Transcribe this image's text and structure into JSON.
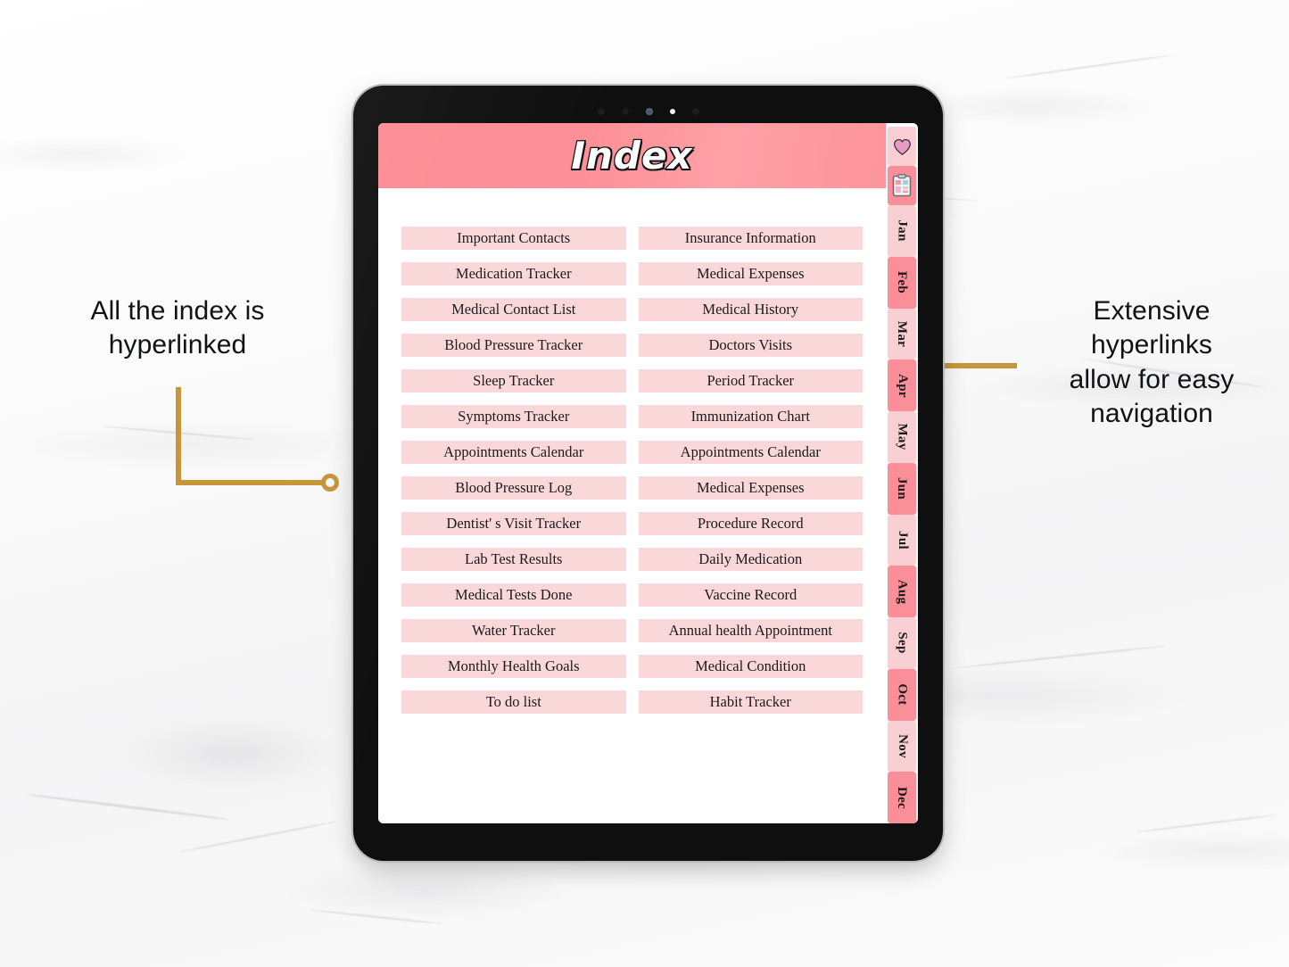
{
  "background": {
    "texture": "white-marble"
  },
  "annotations": {
    "left": {
      "text": "All the index is\nhyperlinked"
    },
    "right": {
      "text": "Extensive\nhyperlinks\nallow for easy\nnavigation"
    },
    "connector_color": "#c8963a"
  },
  "device": {
    "type": "tablet",
    "bezel_color": "#100f10",
    "camera_dots": [
      "dot",
      "dot",
      "camera",
      "led",
      "dot"
    ]
  },
  "page": {
    "title": "Index",
    "header_color": "#fb8b93",
    "button_color": "#fad7d9",
    "columns": [
      {
        "name": "left-column",
        "items": [
          "Important Contacts",
          "Medication Tracker",
          "Medical Contact List",
          "Blood Pressure Tracker",
          "Sleep Tracker",
          "Symptoms Tracker",
          "Appointments Calendar",
          "Blood Pressure Log",
          "Dentist' s Visit Tracker",
          "Lab Test Results",
          "Medical Tests Done",
          "Water Tracker",
          "Monthly Health Goals",
          "To do list"
        ]
      },
      {
        "name": "right-column",
        "items": [
          "Insurance Information",
          "Medical Expenses",
          "Medical History",
          "Doctors Visits",
          "Period Tracker",
          "Immunization Chart",
          "Appointments Calendar",
          "Medical Expenses",
          "Procedure Record",
          "Daily Medication",
          "Vaccine Record",
          "Annual health Appointment",
          "Medical Condition",
          "Habit Tracker"
        ]
      }
    ]
  },
  "tab_strip": {
    "icon_tabs": [
      {
        "icon": "heart-icon",
        "style": "light"
      },
      {
        "icon": "clipboard-icon",
        "style": "dark"
      }
    ],
    "months": [
      {
        "label": "Jan",
        "style": "light"
      },
      {
        "label": "Feb",
        "style": "dark"
      },
      {
        "label": "Mar",
        "style": "light"
      },
      {
        "label": "Apr",
        "style": "dark"
      },
      {
        "label": "May",
        "style": "light"
      },
      {
        "label": "Jun",
        "style": "dark"
      },
      {
        "label": "Jul",
        "style": "light"
      },
      {
        "label": "Aug",
        "style": "dark"
      },
      {
        "label": "Sep",
        "style": "light"
      },
      {
        "label": "Oct",
        "style": "dark"
      },
      {
        "label": "Nov",
        "style": "light"
      },
      {
        "label": "Dec",
        "style": "dark"
      }
    ],
    "light_color": "#f9cfd4",
    "dark_color": "#fa8f99"
  }
}
